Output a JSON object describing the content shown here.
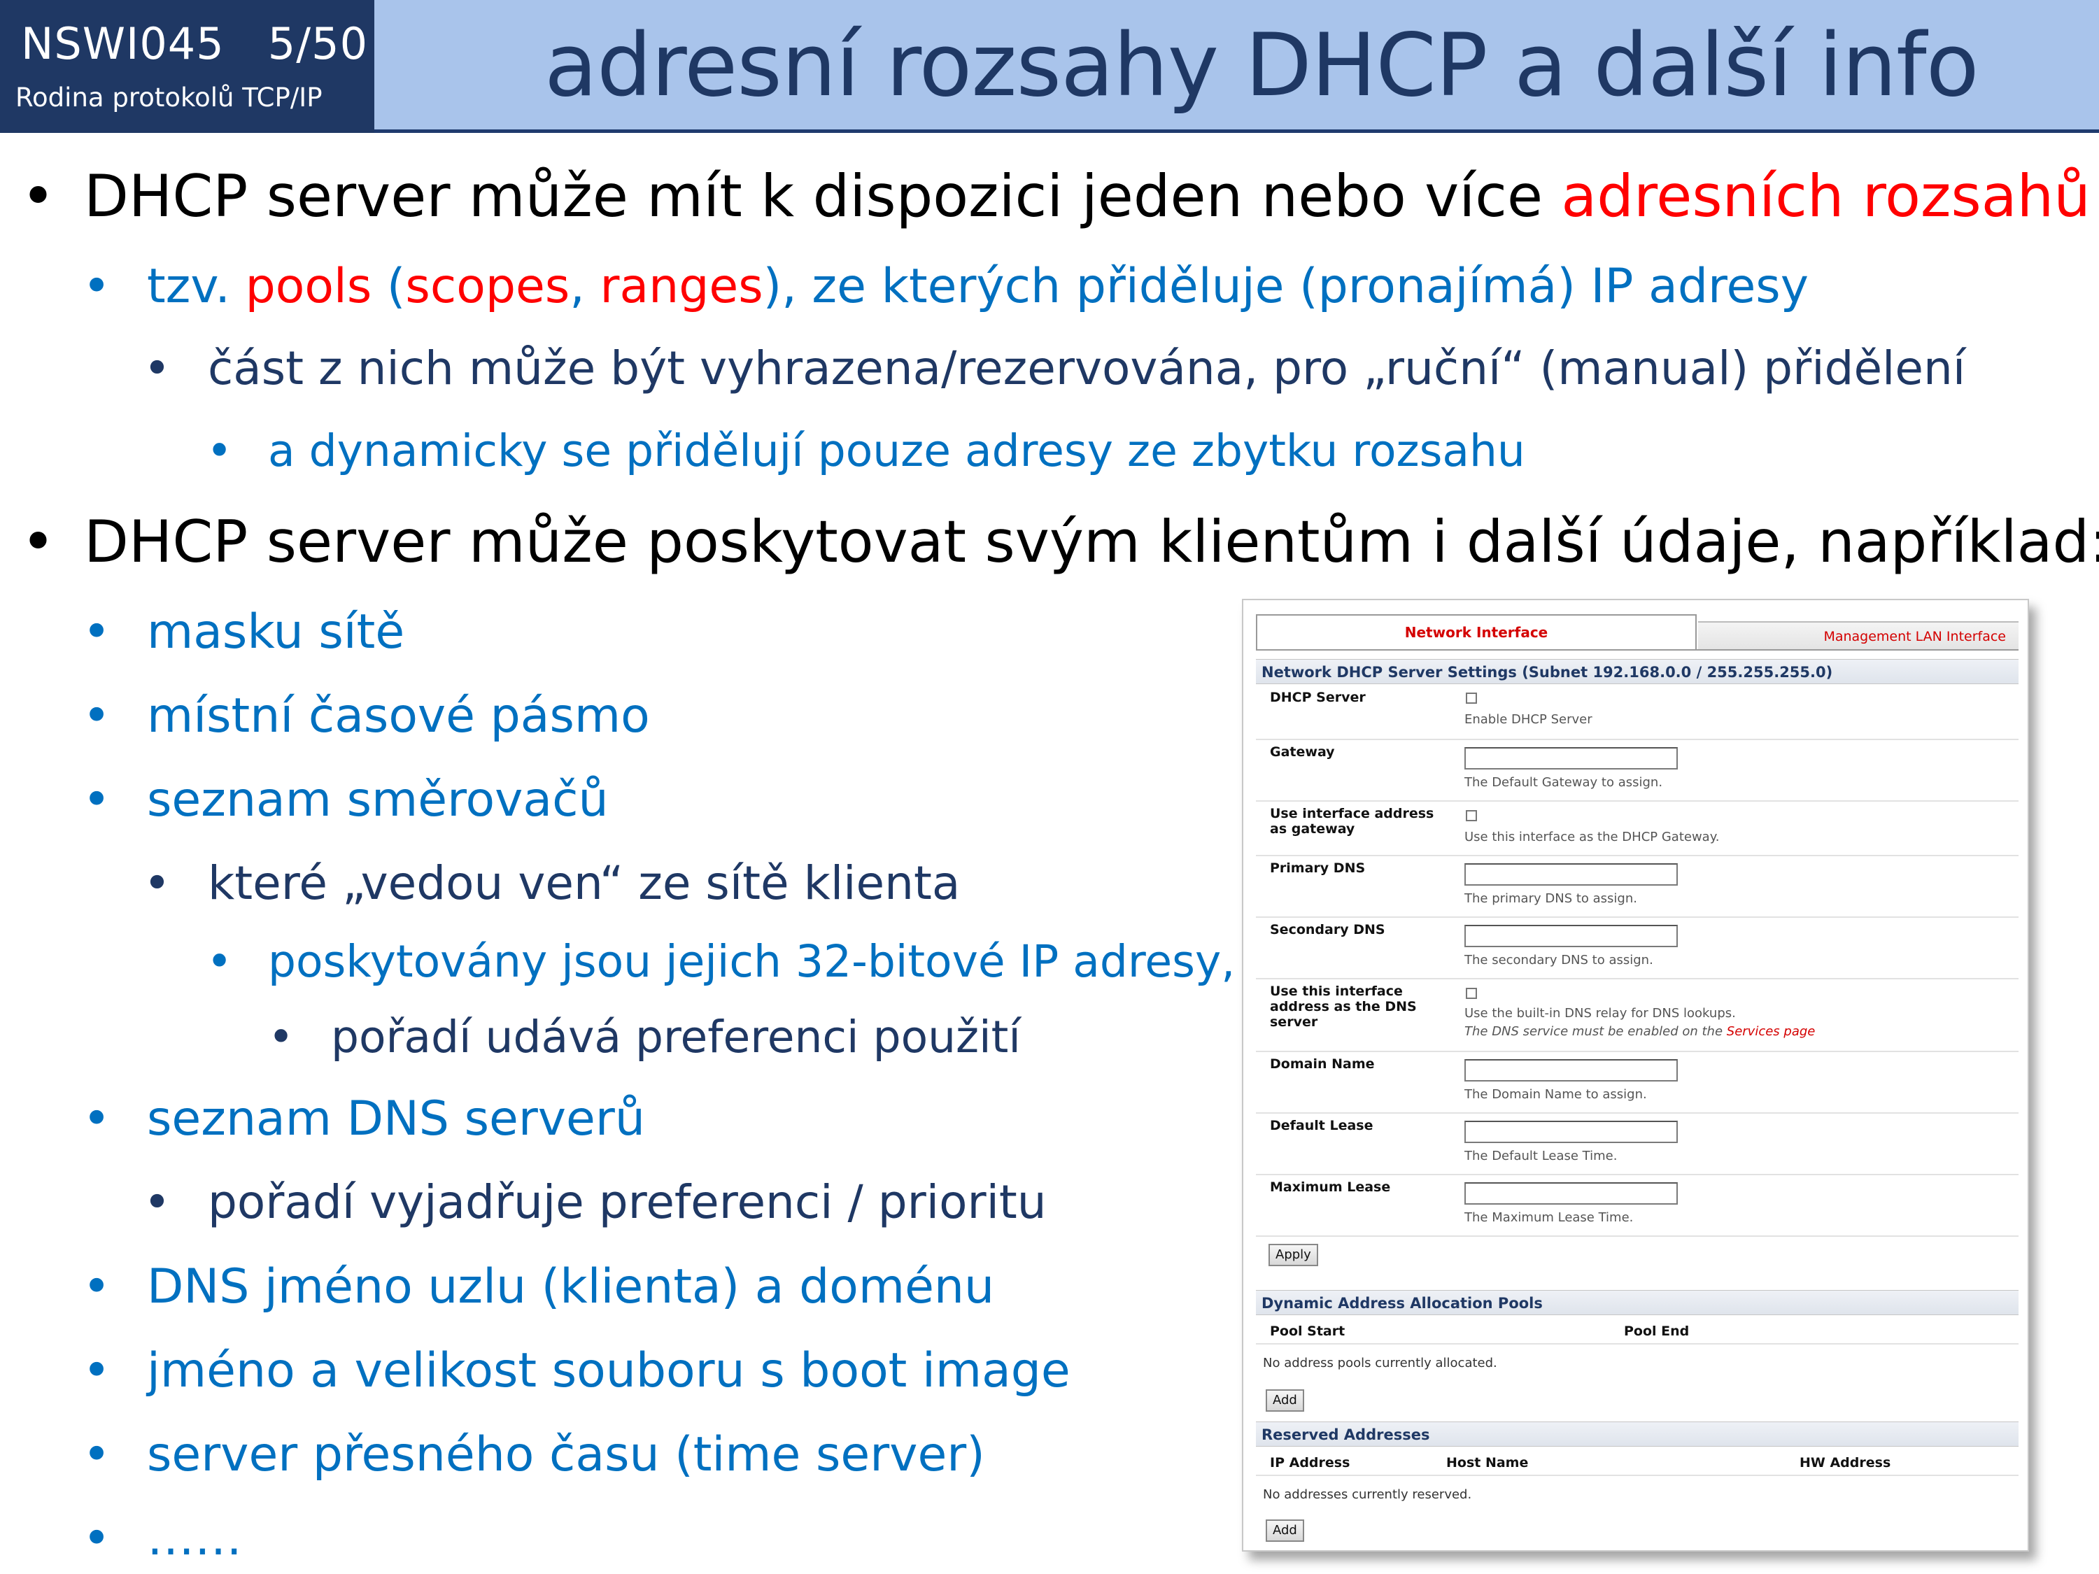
{
  "header": {
    "course": "NSWI045   5/50",
    "subtitle": "Rodina protokolů TCP/IP",
    "title": "adresní rozsahy DHCP a další info"
  },
  "bullets": {
    "b1_text": "DHCP server může mít k dispozici jeden nebo více ",
    "b1_red": "adresních rozsahů",
    "b1_1_a": "tzv. ",
    "b1_1_pools": "pools",
    "b1_1_b": " (",
    "b1_1_scopes": "scopes",
    "b1_1_c": ", ",
    "b1_1_ranges": "ranges",
    "b1_1_d": "), ze kterých přiděluje (pronajímá) IP adresy",
    "b1_1_1": "část z nich může být vyhrazena/rezervována, pro „ruční“ (manual) přidělení",
    "b1_1_1_1": "a dynamicky se přidělují pouze adresy ze zbytku rozsahu",
    "b2": "DHCP server může poskytovat svým klientům i další údaje, například:",
    "b2_1": "masku sítě",
    "b2_2": "místní časové pásmo",
    "b2_3": "seznam směrovačů",
    "b2_3_1": "které „vedou ven“ ze sítě klienta",
    "b2_3_1_1": "poskytovány jsou jejich 32-bitové IP adresy,",
    "b2_3_1_1_1": "pořadí  udává preferenci použití",
    "b2_4": "seznam DNS serverů",
    "b2_4_1": "pořadí vyjadřuje preferenci / prioritu",
    "b2_5": "DNS jméno uzlu (klienta) a doménu",
    "b2_6": "jméno a velikost souboru s boot image",
    "b2_7": "server přesného času (time server)",
    "b2_8": "……",
    "dot": "•"
  },
  "screenshot": {
    "tab_active": "Network Interface",
    "tab_inactive": "Management LAN Interface",
    "section1": "Network DHCP Server Settings (Subnet 192.168.0.0 / 255.255.255.0)",
    "dhcp_server_label": "DHCP Server",
    "dhcp_server_hint": "Enable DHCP Server",
    "gateway_label": "Gateway",
    "gateway_hint": "The Default Gateway to assign.",
    "use_iface_gw_label1": "Use interface address",
    "use_iface_gw_label2": "as gateway",
    "use_iface_gw_hint": "Use this interface as the DHCP Gateway.",
    "primary_dns_label": "Primary DNS",
    "primary_dns_hint": "The primary DNS to assign.",
    "secondary_dns_label": "Secondary DNS",
    "secondary_dns_hint": "The secondary DNS to assign.",
    "use_iface_dns_label1": "Use this interface",
    "use_iface_dns_label2": "address as the DNS",
    "use_iface_dns_label3": "server",
    "use_iface_dns_hint1": "Use the built-in DNS relay for DNS lookups.",
    "use_iface_dns_hint2a": "The DNS service must be enabled on the ",
    "use_iface_dns_hint2b": "Services page",
    "domain_label": "Domain Name",
    "domain_hint": "The Domain Name to assign.",
    "default_lease_label": "Default Lease",
    "default_lease_hint": "The Default Lease Time.",
    "max_lease_label": "Maximum Lease",
    "max_lease_hint": "The Maximum Lease Time.",
    "apply": "Apply",
    "section2": "Dynamic Address Allocation Pools",
    "pool_start": "Pool Start",
    "pool_end": "Pool End",
    "no_pools": "No address pools currently allocated.",
    "add1": "Add",
    "section3": "Reserved Addresses",
    "ip_address": "IP Address",
    "host_name": "Host Name",
    "hw_address": "HW Address",
    "no_reserved": "No addresses currently reserved.",
    "add2": "Add",
    "link_color": "#d40000"
  }
}
